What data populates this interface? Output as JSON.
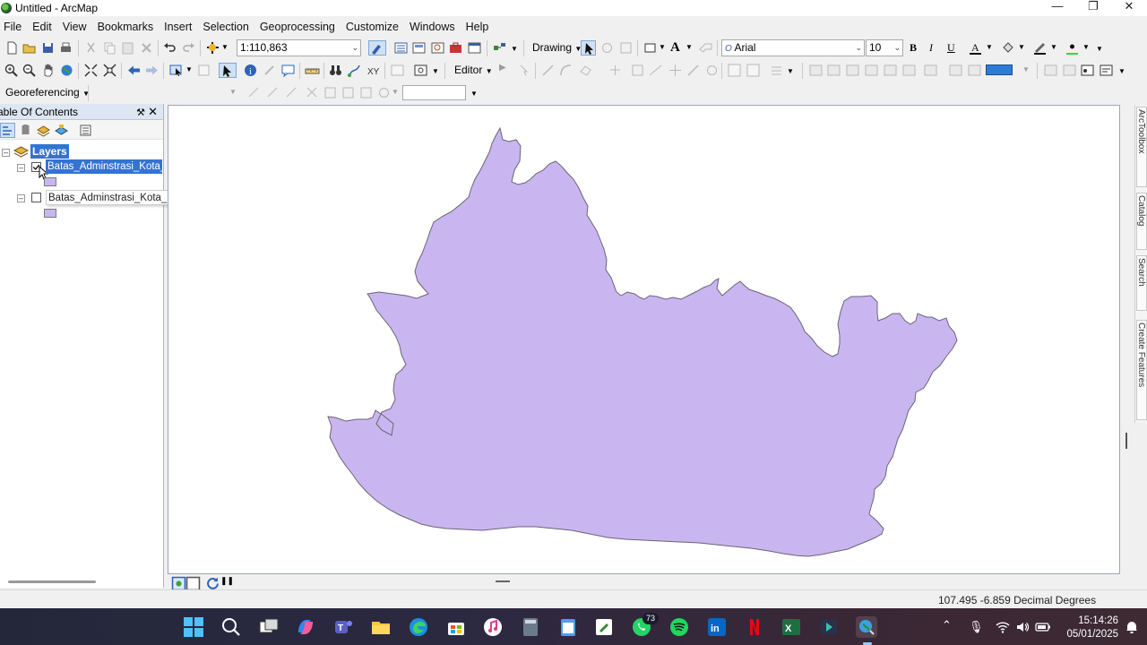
{
  "window": {
    "title": "Untitled - ArcMap"
  },
  "menu": [
    "File",
    "Edit",
    "View",
    "Bookmarks",
    "Insert",
    "Selection",
    "Geoprocessing",
    "Customize",
    "Windows",
    "Help"
  ],
  "standard_toolbar": {
    "scale": "1:110,863"
  },
  "drawing_toolbar": {
    "label": "Drawing",
    "font": "Arial",
    "font_size": "10",
    "bold": "B",
    "italic": "I",
    "underline": "U"
  },
  "tools_toolbar": {
    "editor_label": "Editor"
  },
  "georef_toolbar": {
    "label": "Georeferencing"
  },
  "toc": {
    "title": "able Of Contents",
    "root_label": "Layers",
    "layers": [
      {
        "name": "Batas_Adminstrasi_Kota_Ban",
        "checked": true,
        "selected": true,
        "fill": "#c9b6f0"
      },
      {
        "name": "Batas_Adminstrasi_Kota_Ban",
        "checked": false,
        "selected": false,
        "fill": "#c9b6f0"
      }
    ]
  },
  "map": {
    "polygon_fill": "#c9b6f0",
    "polygon_stroke": "#6a6475",
    "background": "#ffffff"
  },
  "right_dock_tabs": [
    "ArcToolbox",
    "Catalog",
    "Search",
    "Create Features"
  ],
  "status": {
    "coordinates": "107.495  -6.859 Decimal Degrees"
  },
  "taskbar": {
    "whatsapp_badge": "73",
    "time": "15:14:26",
    "date": "05/01/2025"
  }
}
